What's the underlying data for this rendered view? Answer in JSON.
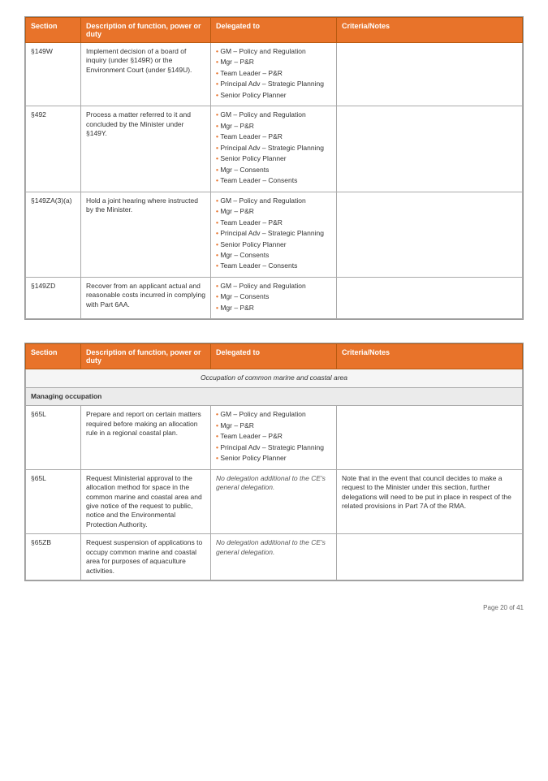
{
  "page": {
    "number": "Page 20 of 41"
  },
  "table1": {
    "headers": {
      "section": "Section",
      "description": "Description of function, power or duty",
      "delegated": "Delegated to",
      "criteria": "Criteria/Notes"
    },
    "rows": [
      {
        "section": "§149W",
        "description": "Implement decision of a board of inquiry (under §149R) or the Environment Court (under §149U).",
        "delegated_items": [
          "GM – Policy and Regulation",
          "Mgr – P&R",
          "Team Leader – P&R",
          "Principal Adv – Strategic Planning",
          "Senior Policy Planner"
        ],
        "criteria": ""
      },
      {
        "section": "§492",
        "description": "Process a matter referred to it and concluded by the Minister under §149Y.",
        "delegated_items": [
          "GM – Policy and Regulation",
          "Mgr – P&R",
          "Team Leader – P&R",
          "Principal Adv – Strategic Planning",
          "Senior Policy Planner",
          "Mgr – Consents",
          "Team Leader – Consents"
        ],
        "criteria": ""
      },
      {
        "section": "§149ZA(3)(a)",
        "description": "Hold a joint hearing where instructed by the Minister.",
        "delegated_items": [
          "GM – Policy and Regulation",
          "Mgr – P&R",
          "Team Leader – P&R",
          "Principal Adv – Strategic Planning",
          "Senior Policy Planner",
          "Mgr – Consents",
          "Team Leader – Consents"
        ],
        "criteria": ""
      },
      {
        "section": "§149ZD",
        "description": "Recover from an applicant actual and reasonable costs incurred in complying with Part 6AA.",
        "delegated_items": [
          "GM – Policy and Regulation",
          "Mgr – Consents",
          "Mgr – P&R"
        ],
        "criteria": ""
      }
    ]
  },
  "table2": {
    "headers": {
      "section": "Section",
      "description": "Description of function, power or duty",
      "delegated": "Delegated to",
      "criteria": "Criteria/Notes"
    },
    "group_header": "Occupation of common marine and coastal area",
    "sub_header": "Managing occupation",
    "rows": [
      {
        "section": "§65L",
        "description": "Prepare and report on certain matters required before making an allocation rule in a regional coastal plan.",
        "delegated_items": [
          "GM – Policy and Regulation",
          "Mgr – P&R",
          "Team Leader – P&R",
          "Principal Adv – Strategic Planning",
          "Senior Policy Planner"
        ],
        "criteria": ""
      },
      {
        "section": "§65L",
        "description": "Request Ministerial approval to the allocation method for space in the common marine and coastal area and give notice of the request to public, notice and the Environmental Protection Authority.",
        "delegated_items_italic": "No delegation additional to the CE's general delegation.",
        "criteria": "Note that in the event that council decides to make a request to the Minister under this section, further delegations will need to be put in place in respect of the related provisions in Part 7A of the RMA."
      },
      {
        "section": "§65ZB",
        "description": "Request suspension of applications to occupy common marine and coastal area for purposes of aquaculture activities.",
        "delegated_items_italic": "No delegation additional to the CE's general delegation.",
        "criteria": ""
      }
    ]
  }
}
